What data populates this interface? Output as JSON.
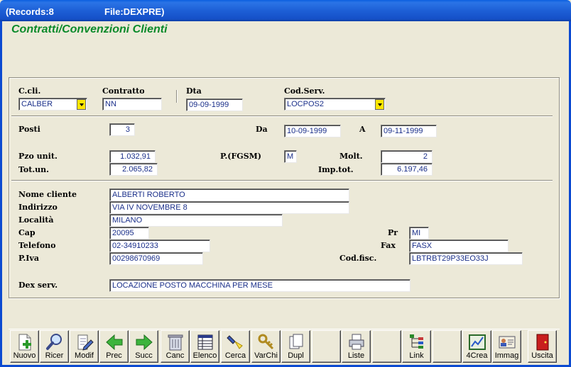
{
  "titlebar": {
    "records": "(Records:8",
    "file": "File:DEXPRE)"
  },
  "form": {
    "title": "Contratti/Convenzioni Clienti"
  },
  "header": {
    "ccli_label": "C.cli.",
    "ccli_value": "CALBER",
    "contratto_label": "Contratto",
    "contratto_value": "NN",
    "dta_label": "Dta",
    "dta_value": "09-09-1999",
    "codserv_label": "Cod.Serv.",
    "codserv_value": "LOCPOS2"
  },
  "details": {
    "posti_label": "Posti",
    "posti_value": "3",
    "da_label": "Da",
    "da_value": "10-09-1999",
    "a_label": "A",
    "a_value": "09-11-1999",
    "pzo_label": "Pzo unit.",
    "pzo_value": "1.032,91",
    "pfgsm_label": "P.(FGSM)",
    "pfgsm_value": "M",
    "molt_label": "Molt.",
    "molt_value": "2",
    "totun_label": "Tot.un.",
    "totun_value": "2.065,82",
    "imptot_label": "Imp.tot.",
    "imptot_value": "6.197,46"
  },
  "client": {
    "nome_label": "Nome cliente",
    "nome_value": "ALBERTI ROBERTO",
    "indirizzo_label": "Indirizzo",
    "indirizzo_value": "VIA IV NOVEMBRE 8",
    "localita_label": "Località",
    "localita_value": "MILANO",
    "cap_label": "Cap",
    "cap_value": "20095",
    "pr_label": "Pr",
    "pr_value": "MI",
    "telefono_label": "Telefono",
    "telefono_value": "02-34910233",
    "fax_label": "Fax",
    "fax_value": "FASX",
    "piva_label": "P.Iva",
    "piva_value": "00298670969",
    "codfisc_label": "Cod.fisc.",
    "codfisc_value": "LBTRBT29P33EO33J",
    "dexserv_label": "Dex serv.",
    "dexserv_value": "LOCAZIONE POSTO MACCHINA PER MESE"
  },
  "toolbar": {
    "nuovo": "Nuovo",
    "ricer": "Ricer",
    "modif": "Modif",
    "prec": "Prec",
    "succ": "Succ",
    "canc": "Canc",
    "elenco": "Elenco",
    "cerca": "Cerca",
    "varchi": "VarChi",
    "dupl": "Dupl",
    "liste": "Liste",
    "link": "Link",
    "crea4": "4Crea",
    "immag": "Immag",
    "uscita": "Uscita"
  }
}
